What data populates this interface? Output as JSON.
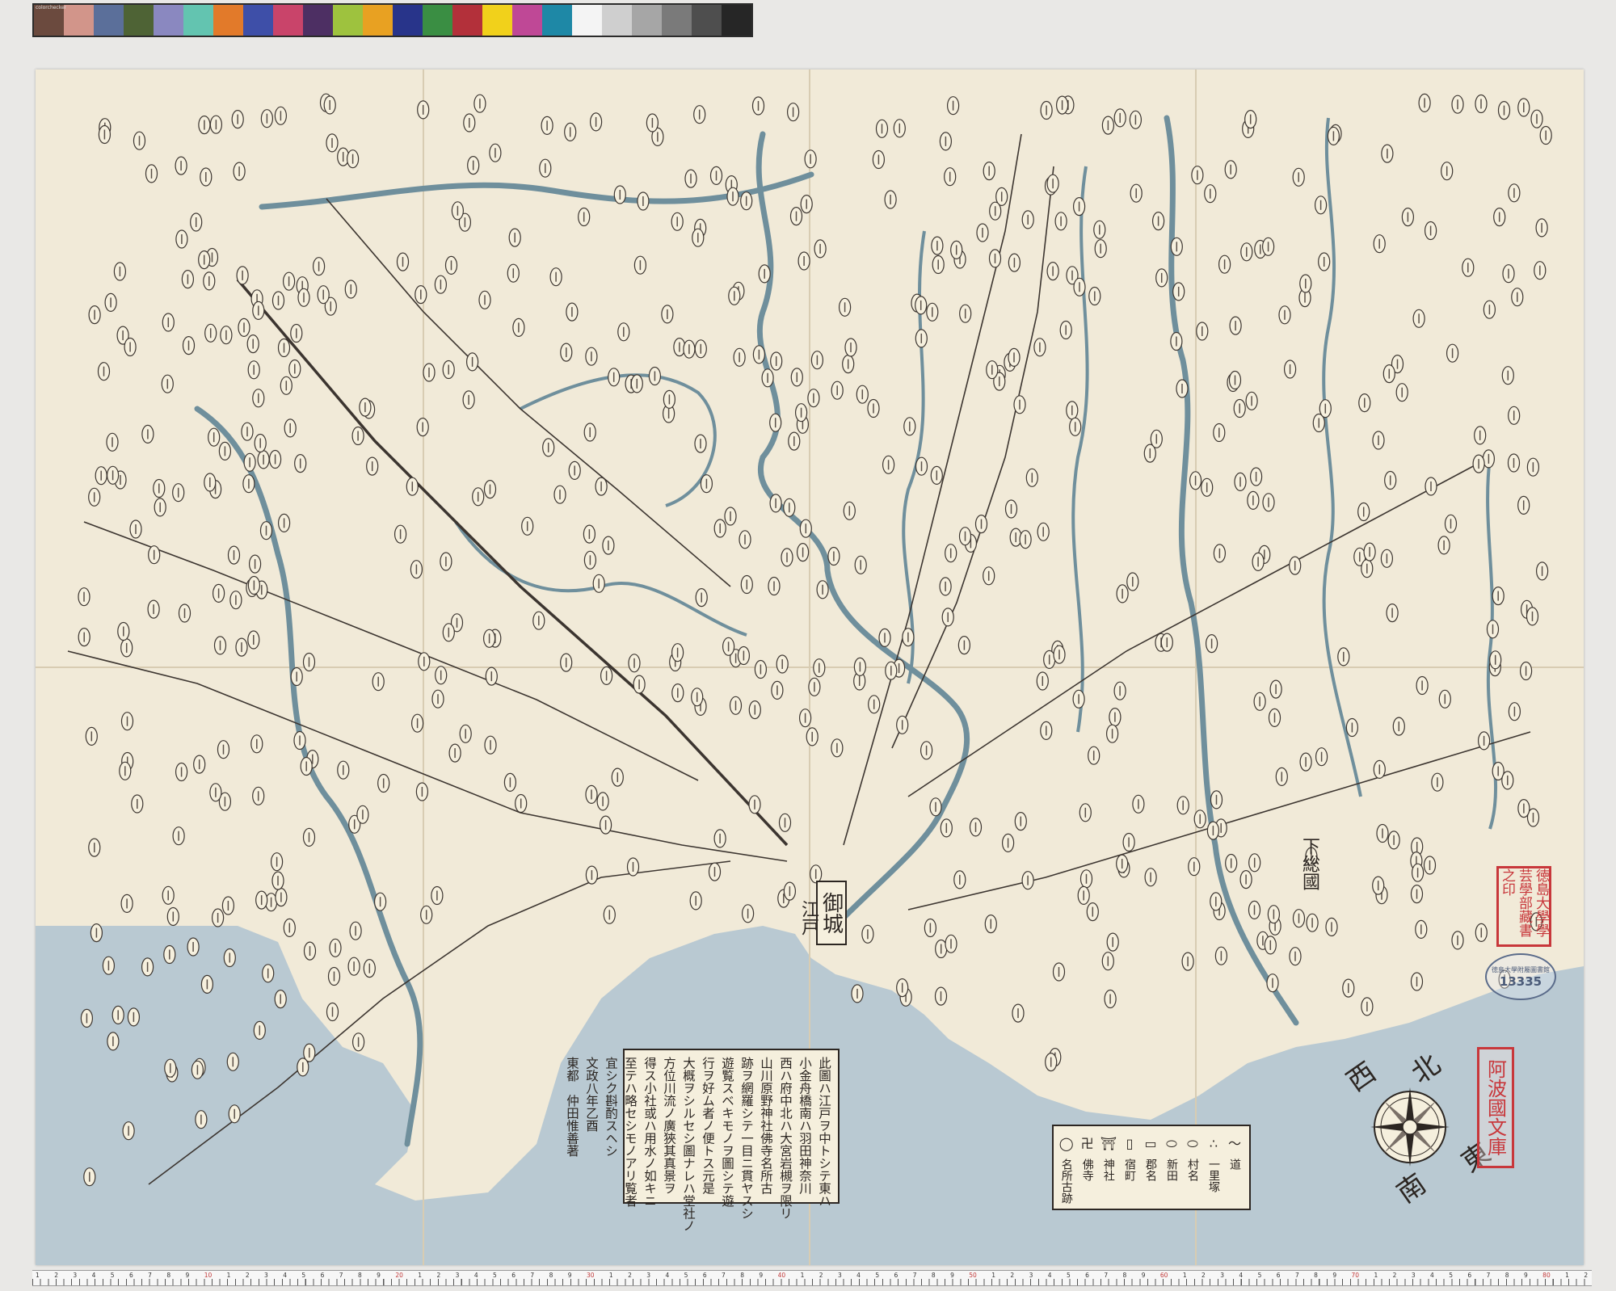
{
  "calibration_colors": [
    "#6b4a3e",
    "#d2958a",
    "#5b6f9a",
    "#4e6335",
    "#8a88c0",
    "#63c4b0",
    "#e27a2a",
    "#3e4fa8",
    "#c9446a",
    "#4d2f63",
    "#9ec23e",
    "#e8a122",
    "#28348a",
    "#3a8e43",
    "#b3303a",
    "#f1d11b",
    "#bf4896",
    "#1e88a6",
    "#f4f4f4",
    "#cfcfcf",
    "#a6a6a6",
    "#7a7a7a",
    "#4e4e4e",
    "#262626"
  ],
  "calibration_caption": "colorchecker",
  "map": {
    "castle_label": "御城",
    "city_label": "江戸",
    "place_labels": [
      "下総國",
      "阿波國文庫"
    ],
    "colophon_lines": [
      "此圖ハ江戸ヲ中トシテ東ハ",
      "小金舟橋南ハ羽田神奈川",
      "西ハ府中北ハ大宮岩槻ヲ限リ",
      "山川原野神社佛寺名所古",
      "跡ヲ網羅シテ一目ニ貫ヤスシ",
      "遊覧スベキモノヲ圖シテ遊",
      "行ヲ好ム者ノ便トス元是",
      "大概ヲシルセシ圖ナレハ堂社ノ",
      "方位川流ノ廣狹其真景ヲ",
      "得ス小社或ハ用水ノ如キニ",
      "至テハ略セシモノアリ覧者",
      "宜シク斟酌スヘシ",
      "文政八年乙酉",
      "東都　仲田惟善著"
    ],
    "legend": [
      {
        "symbol": "〜",
        "label": "道"
      },
      {
        "symbol": "∴",
        "label": "一里塚"
      },
      {
        "symbol": "⬭",
        "label": "村名"
      },
      {
        "symbol": "⬭",
        "label": "新田"
      },
      {
        "symbol": "▭",
        "label": "郡名"
      },
      {
        "symbol": "▯",
        "label": "宿町"
      },
      {
        "symbol": "⛩",
        "label": "神社"
      },
      {
        "symbol": "卍",
        "label": "佛寺"
      },
      {
        "symbol": "◯",
        "label": "名所古跡"
      }
    ],
    "compass": {
      "north": "北",
      "south": "南",
      "east": "東",
      "west": "西"
    },
    "stamp_library": "阿波國文庫",
    "stamp_university": "徳島大學學芸學部藏書之印",
    "stamp_id": "13335",
    "stamp_id_caption": "徳島大學附屬圖書館"
  },
  "ruler": {
    "numbers": [
      "1",
      "2",
      "3",
      "4",
      "5",
      "6",
      "7",
      "8",
      "9",
      "10",
      "1",
      "2",
      "3",
      "4",
      "5",
      "6",
      "7",
      "8",
      "9",
      "20",
      "1",
      "2",
      "3",
      "4",
      "5",
      "6",
      "7",
      "8",
      "9",
      "30",
      "1",
      "2",
      "3",
      "4",
      "5",
      "6",
      "7",
      "8",
      "9",
      "40",
      "1",
      "2",
      "3",
      "4",
      "5",
      "6",
      "7",
      "8",
      "9",
      "50",
      "1",
      "2",
      "3",
      "4",
      "5",
      "6",
      "7",
      "8",
      "9",
      "60",
      "1",
      "2",
      "3",
      "4",
      "5",
      "6",
      "7",
      "8",
      "9",
      "70",
      "1",
      "2",
      "3",
      "4",
      "5",
      "6",
      "7",
      "8",
      "9",
      "80",
      "1",
      "2"
    ]
  }
}
